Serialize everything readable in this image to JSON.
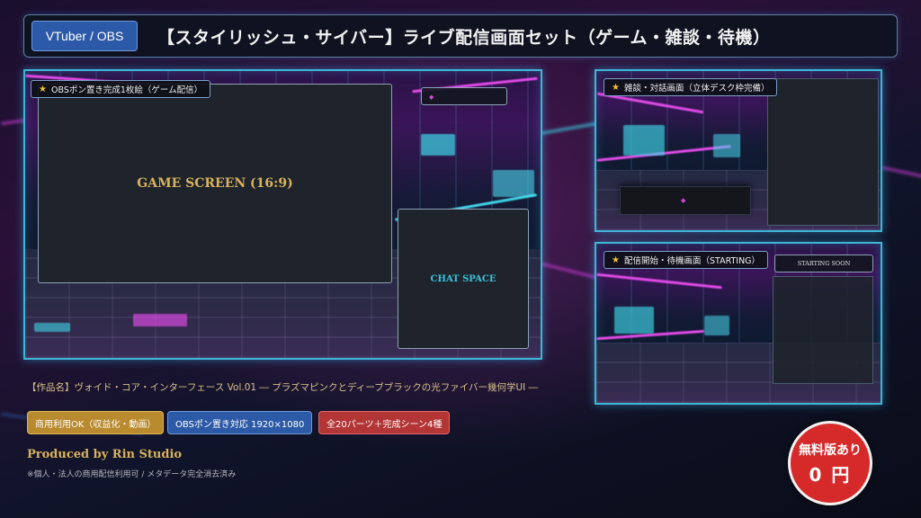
{
  "header": {
    "badge": "VTuber / OBS",
    "title": "【スタイリッシュ・サイバー】ライブ配信画面セット（ゲーム・雑談・待機）"
  },
  "main_scene": {
    "label": "OBSポン置き完成1枚絵（ゲーム配信）",
    "game_screen_text": "GAME SCREEN (16:9)",
    "chat_space_text": "CHAT SPACE"
  },
  "talk_scene": {
    "label": "雑談・対話画面（立体デスク枠完備）"
  },
  "starting_scene": {
    "label": "配信開始・待機画面（STARTING）",
    "starting_soon_text": "STARTING SOON"
  },
  "info": {
    "work_name": "【作品名】ヴォイド・コア・インターフェース Vol.01 ― プラズマピンクとディーブブラックの光ファイバー幾何学UI ―",
    "tags": [
      "商用利用OK（収益化・動画）",
      "OBSポン置き対応 1920×1080",
      "全20パーツ＋完成シーン4種"
    ],
    "produced_by": "Produced by Rin Studio",
    "note": "※個人・法人の商用配信利用可 / メタデータ完全消去済み"
  },
  "price": {
    "line1": "無料版あり",
    "line2": "0 円"
  },
  "icons": {
    "label_star": "star-icon"
  },
  "colors": {
    "accent_cyan": "#3fb6d8",
    "accent_magenta": "#d04ad8",
    "gold": "#d8b25c",
    "badge_blue": "#2c5aa8",
    "price_red": "#d62a2a"
  }
}
